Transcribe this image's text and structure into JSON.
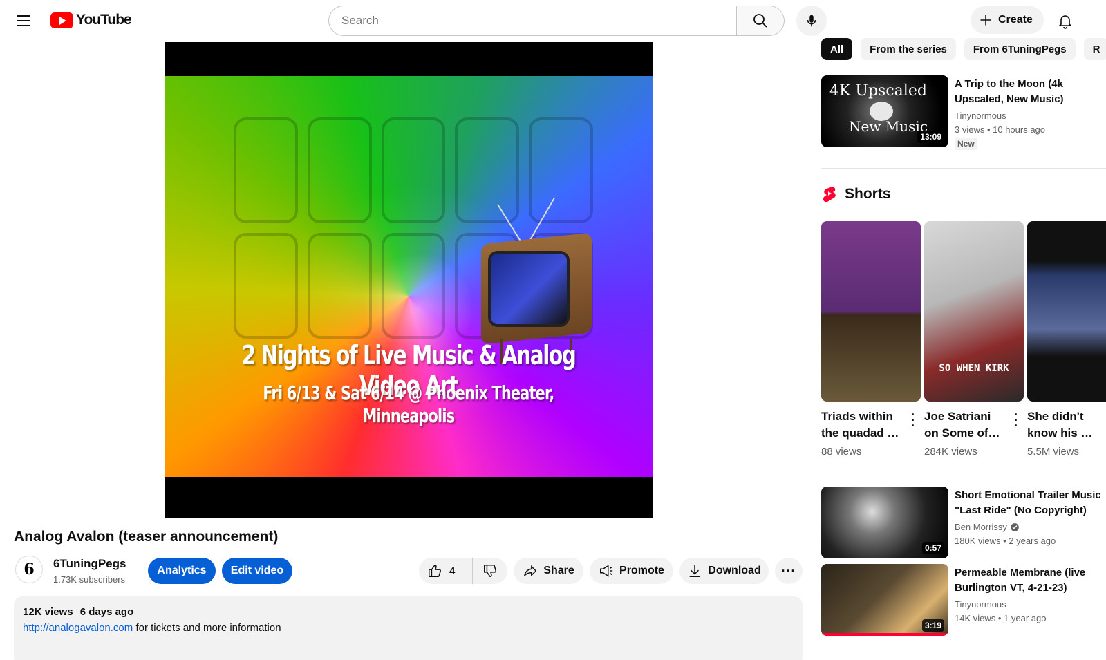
{
  "header": {
    "logo_text": "YouTube",
    "search_placeholder": "Search",
    "create_label": "Create"
  },
  "player": {
    "overlay_line1": "2 Nights of Live Music & Analog Video Art",
    "overlay_line2": "Fri 6/13 & Sat 6/14 @ Phoenix Theater, Minneapolis"
  },
  "video": {
    "title": "Analog Avalon (teaser announcement)",
    "channel": {
      "name": "6TuningPegs",
      "subscribers": "1.73K subscribers",
      "avatar_glyph": "6"
    },
    "buttons": {
      "analytics": "Analytics",
      "edit": "Edit video",
      "like_count": "4",
      "share": "Share",
      "promote": "Promote",
      "download": "Download",
      "more": "···"
    },
    "description": {
      "views": "12K views",
      "date": "6 days ago",
      "link": "http://analogavalon.com",
      "link_suffix": " for tickets and more information"
    }
  },
  "sidebar": {
    "chips": [
      "All",
      "From the series",
      "From 6TuningPegs",
      "R"
    ],
    "top_video": {
      "title_line1": "A Trip to the Moon (4k",
      "title_line2": "Upscaled, New Music)",
      "channel": "Tinynormous",
      "stats": "3 views  •  10 hours ago",
      "badge": "New",
      "duration": "13:09",
      "thumb_text1": "4K Upscaled",
      "thumb_text2": "New Music"
    },
    "shorts_label": "Shorts",
    "shorts": [
      {
        "title_line1": "Triads within",
        "title_line2": "the quadad …",
        "views": "88 views",
        "caption": ""
      },
      {
        "title_line1": "Joe Satriani",
        "title_line2": "on Some of…",
        "views": "284K views",
        "caption": "SO WHEN KIRK"
      },
      {
        "title_line1": "She didn't",
        "title_line2": "know his …",
        "views": "5.5M views",
        "caption": ""
      }
    ],
    "videos": [
      {
        "title_line1": "Short Emotional Trailer Music",
        "title_line2": "\"Last Ride\" (No Copyright)",
        "channel": "Ben Morrissy",
        "stats": "180K views  •  2 years ago",
        "duration": "0:57",
        "verified": true
      },
      {
        "title_line1": "Permeable Membrane (live",
        "title_line2": "Burlington VT, 4-21-23)",
        "channel": "Tinynormous",
        "stats": "14K views  •  1 year ago",
        "duration": "3:19",
        "verified": false
      }
    ]
  },
  "colors": {
    "brand_red": "#ff0000",
    "accent_blue": "#065fd4",
    "pill_gray": "#f2f2f2"
  }
}
